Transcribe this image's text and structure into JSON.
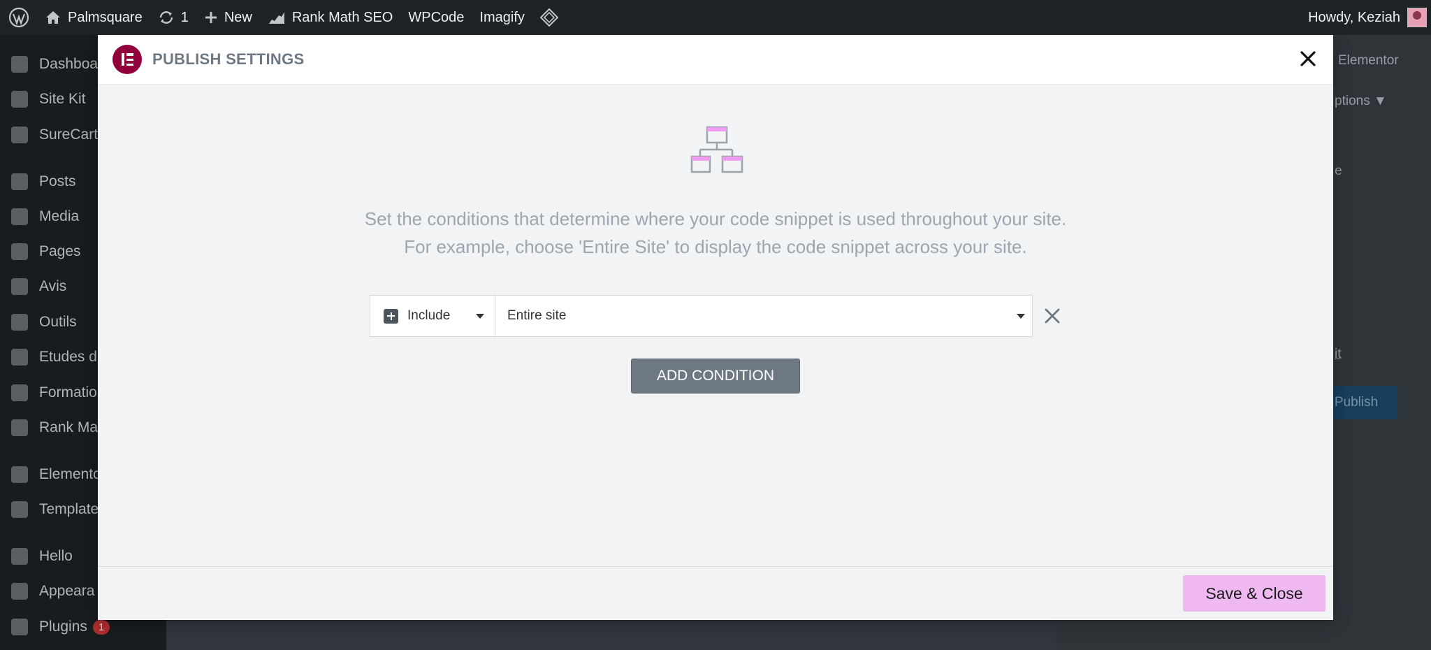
{
  "adminbar": {
    "site_name": "Palmsquare",
    "updates_count": "1",
    "new_label": "New",
    "rank_math_label": "Rank Math SEO",
    "wpcode_label": "WPCode",
    "imagify_label": "Imagify",
    "greeting": "Howdy, Keziah"
  },
  "sidebar": {
    "items": [
      {
        "label": "Dashboa"
      },
      {
        "label": "Site Kit"
      },
      {
        "label": "SureCart"
      },
      {
        "label": "Posts"
      },
      {
        "label": "Media"
      },
      {
        "label": "Pages"
      },
      {
        "label": "Avis"
      },
      {
        "label": "Outils"
      },
      {
        "label": "Etudes d"
      },
      {
        "label": "Formatio"
      },
      {
        "label": "Rank Ma"
      },
      {
        "label": "Elemento"
      },
      {
        "label": "Template"
      },
      {
        "label": "Hello"
      },
      {
        "label": "Appeara"
      },
      {
        "label": "Plugins"
      }
    ],
    "plugins_badge": "1"
  },
  "background": {
    "elementor_label": "Elementor",
    "options_label": "ptions ▼",
    "letter_e": "e",
    "link_t": "it",
    "publish_label": "Publish"
  },
  "modal": {
    "title": "PUBLISH SETTINGS",
    "description_line1": "Set the conditions that determine where your code snippet is used throughout your site.",
    "description_line2": "For example, choose 'Entire Site' to display the code snippet across your site.",
    "condition": {
      "type_value": "Include",
      "scope_value": "Entire site"
    },
    "add_condition_label": "ADD CONDITION",
    "save_close_label": "Save & Close"
  },
  "colors": {
    "elementor_brand": "#92003b",
    "save_button": "#f0b8f1",
    "add_button": "#6d7882",
    "adminbar": "#1d2327"
  }
}
